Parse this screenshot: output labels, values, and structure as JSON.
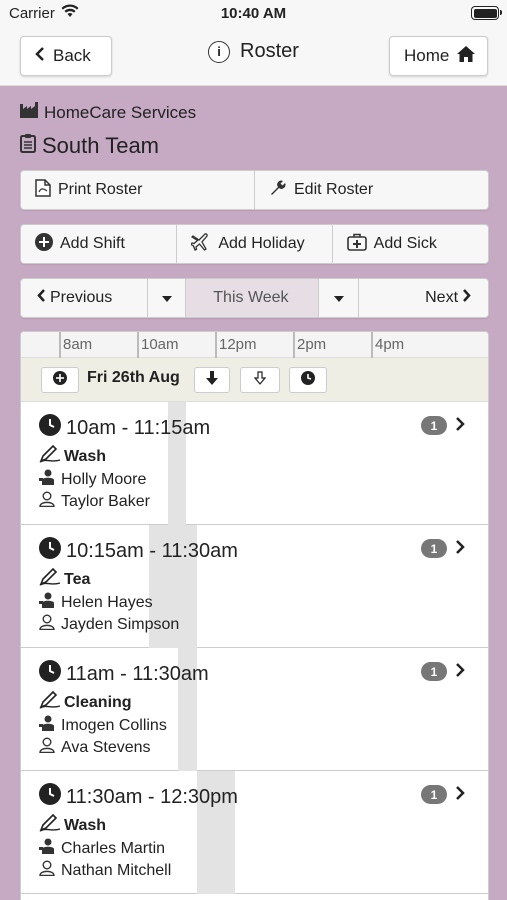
{
  "status_bar": {
    "carrier": "Carrier",
    "time": "10:40 AM"
  },
  "navbar": {
    "back_label": "Back",
    "title": "Roster",
    "home_label": "Home"
  },
  "header": {
    "organisation": "HomeCare Services",
    "team": "South Team"
  },
  "roster_actions": {
    "print_label": "Print Roster",
    "edit_label": "Edit Roster"
  },
  "add_actions": {
    "shift_label": "Add Shift",
    "holiday_label": "Add Holiday",
    "sick_label": "Add Sick"
  },
  "week_nav": {
    "previous_label": "Previous",
    "current_label": "This Week",
    "next_label": "Next"
  },
  "timeline": {
    "ticks": [
      "8am",
      "10am",
      "12pm",
      "2pm",
      "4pm"
    ]
  },
  "day": {
    "label": "Fri 26th Aug"
  },
  "shifts": [
    {
      "time": "10am - 11:15am",
      "task": "Wash",
      "person1": "Holly Moore",
      "person2": "Taylor Baker",
      "badge": "1"
    },
    {
      "time": "10:15am - 11:30am",
      "task": "Tea",
      "person1": "Helen Hayes",
      "person2": "Jayden Simpson",
      "badge": "1"
    },
    {
      "time": "11am - 11:30am",
      "task": "Cleaning",
      "person1": "Imogen Collins",
      "person2": "Ava Stevens",
      "badge": "1"
    },
    {
      "time": "11:30am - 12:30pm",
      "task": "Wash",
      "person1": "Charles Martin",
      "person2": "Nathan Mitchell",
      "badge": "1"
    }
  ],
  "colors": {
    "background": "#c6a9c3",
    "panel": "#ffffff",
    "day_row": "#eeeee4",
    "badge": "#777777",
    "shift_bar": "#e3e3e3"
  },
  "icons": [
    "wifi-icon",
    "battery-icon",
    "chevron-left-icon",
    "info-icon",
    "home-icon",
    "building-icon",
    "clipboard-icon",
    "pdf-icon",
    "wrench-icon",
    "plus-circle-icon",
    "plane-icon",
    "medical-icon",
    "caret-down-icon",
    "chevron-right-icon",
    "clock-icon",
    "pen-icon",
    "carer-icon",
    "user-icon",
    "arrow-down-icon"
  ]
}
